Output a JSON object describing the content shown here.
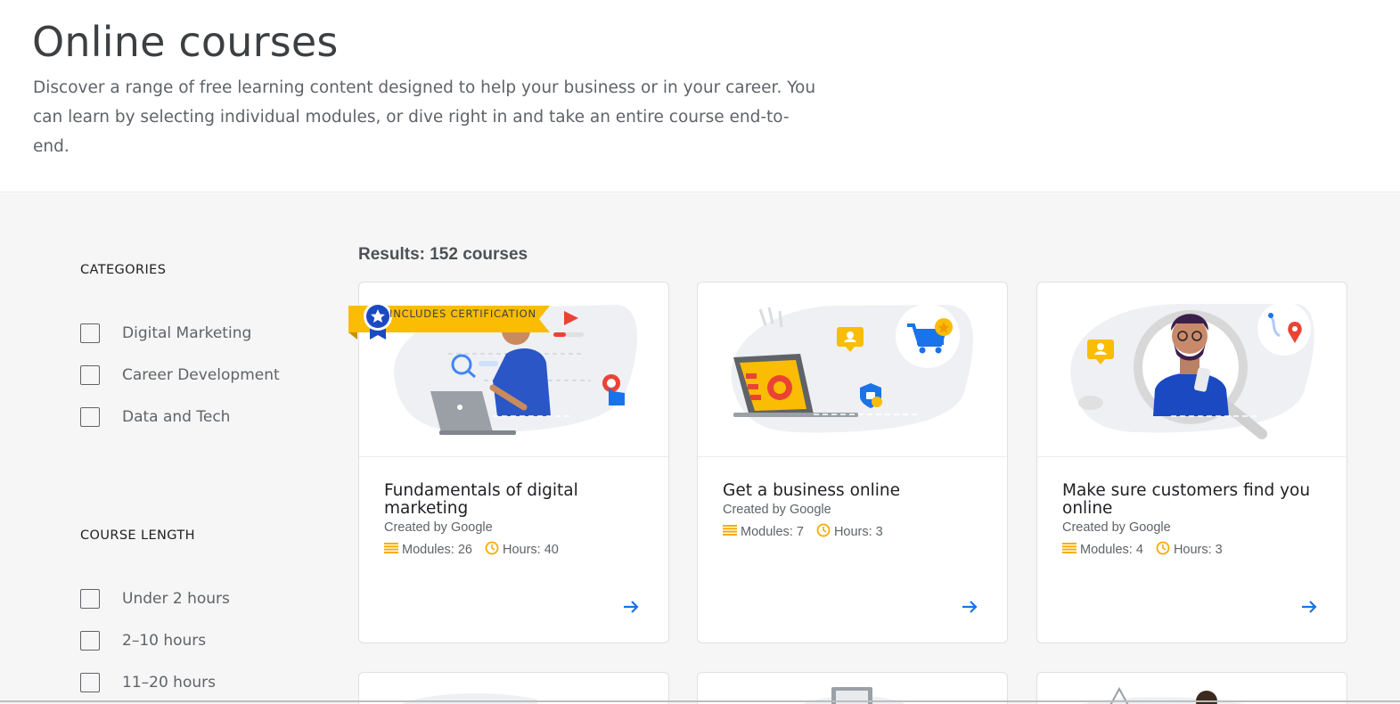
{
  "header": {
    "title": "Online courses",
    "description": "Discover a range of free learning content designed to help your business or in your career. You can learn by selecting individual modules, or dive right in and take an entire course end-to-end."
  },
  "filters": {
    "categories": {
      "title": "CATEGORIES",
      "options": [
        "Digital Marketing",
        "Career Development",
        "Data and Tech"
      ]
    },
    "course_length": {
      "title": "COURSE LENGTH",
      "options": [
        "Under 2 hours",
        "2–10 hours",
        "11–20 hours"
      ]
    }
  },
  "results": {
    "label": "Results: 152 courses"
  },
  "courses": [
    {
      "badge": "INCLUDES CERTIFICATION",
      "title": "Fundamentals of digital marketing",
      "created_by": "Created by Google",
      "modules": "Modules: 26",
      "hours": "Hours: 40"
    },
    {
      "title": "Get a business online",
      "created_by": "Created by Google",
      "modules": "Modules: 7",
      "hours": "Hours: 3"
    },
    {
      "title": "Make sure customers find you online",
      "created_by": "Created by Google",
      "modules": "Modules: 4",
      "hours": "Hours: 3"
    }
  ],
  "colors": {
    "accent_blue": "#1a73e8",
    "badge_yellow": "#fbbc04",
    "icon_yellow": "#f9ab00",
    "page_bg": "#f6f6f6"
  }
}
